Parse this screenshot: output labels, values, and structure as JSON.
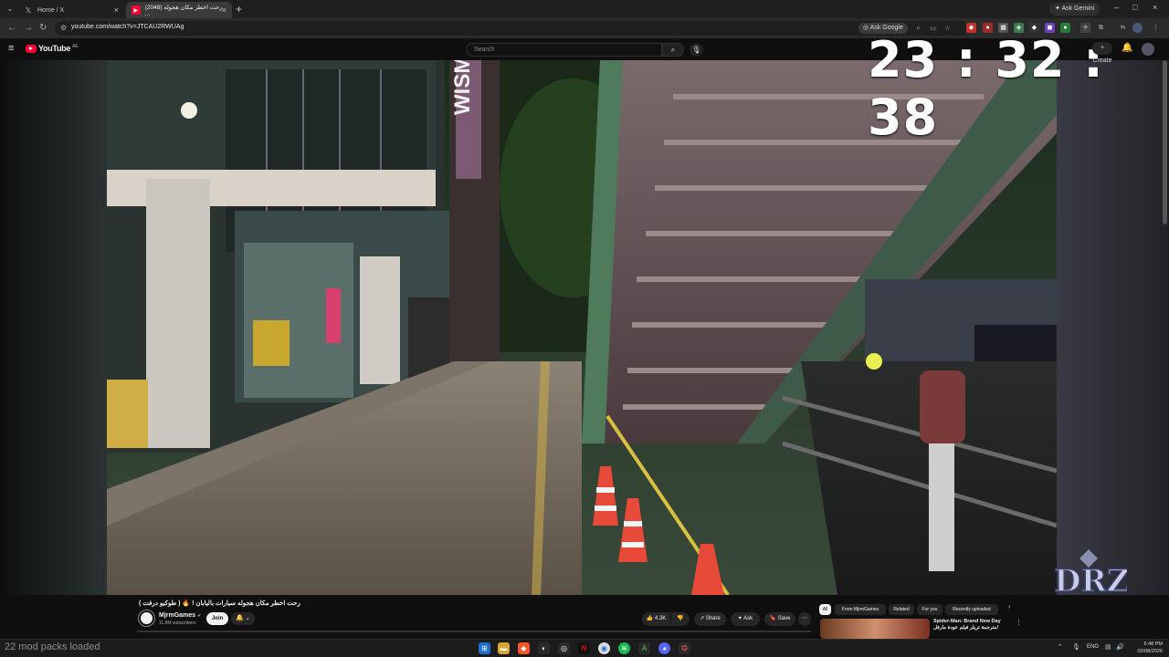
{
  "browser": {
    "tabs": [
      {
        "label": "Home / X",
        "icon": "x-logo-icon"
      },
      {
        "label": "(2048) رحت اخطر مكان هجوله ...",
        "icon": "youtube-favicon-icon"
      }
    ],
    "ask_gemini": "Ask Gemini",
    "url": "youtube.com/watch?v=JTCAU2RWUAg",
    "ask_google": "Ask Google"
  },
  "youtube": {
    "logo_word": "YouTube",
    "logo_country": "AE",
    "search_placeholder": "Search",
    "create_label": "+ Create",
    "clock": "23 : 32 : 38",
    "video_title": "رحت اخطر مكان هجوله سيارات باليابان ! 🔥 ( طوكيو درفت )",
    "channel_name": "MjrmGames",
    "channel_subs": "11.8M subscribers",
    "join_label": "Join",
    "like_count": "4.3K",
    "share_label": "Share",
    "ask_label": "Ask",
    "save_label": "Save",
    "chips": [
      "All",
      "From MjrmGames",
      "Related",
      "For you",
      "Recently uploaded"
    ],
    "recommendation_title": "Spider-Man: Brand New Day مترجمة تريلر فيلم عودة مارفل!"
  },
  "taskbar": {
    "mod_packs": "22 mod packs loaded",
    "language": "ENG",
    "time": "6:48 PM",
    "date": "02/08/2026"
  },
  "colors": {
    "youtube_red": "#ff0033",
    "page_bg": "#0f0f0f",
    "pill_bg": "#272727"
  }
}
